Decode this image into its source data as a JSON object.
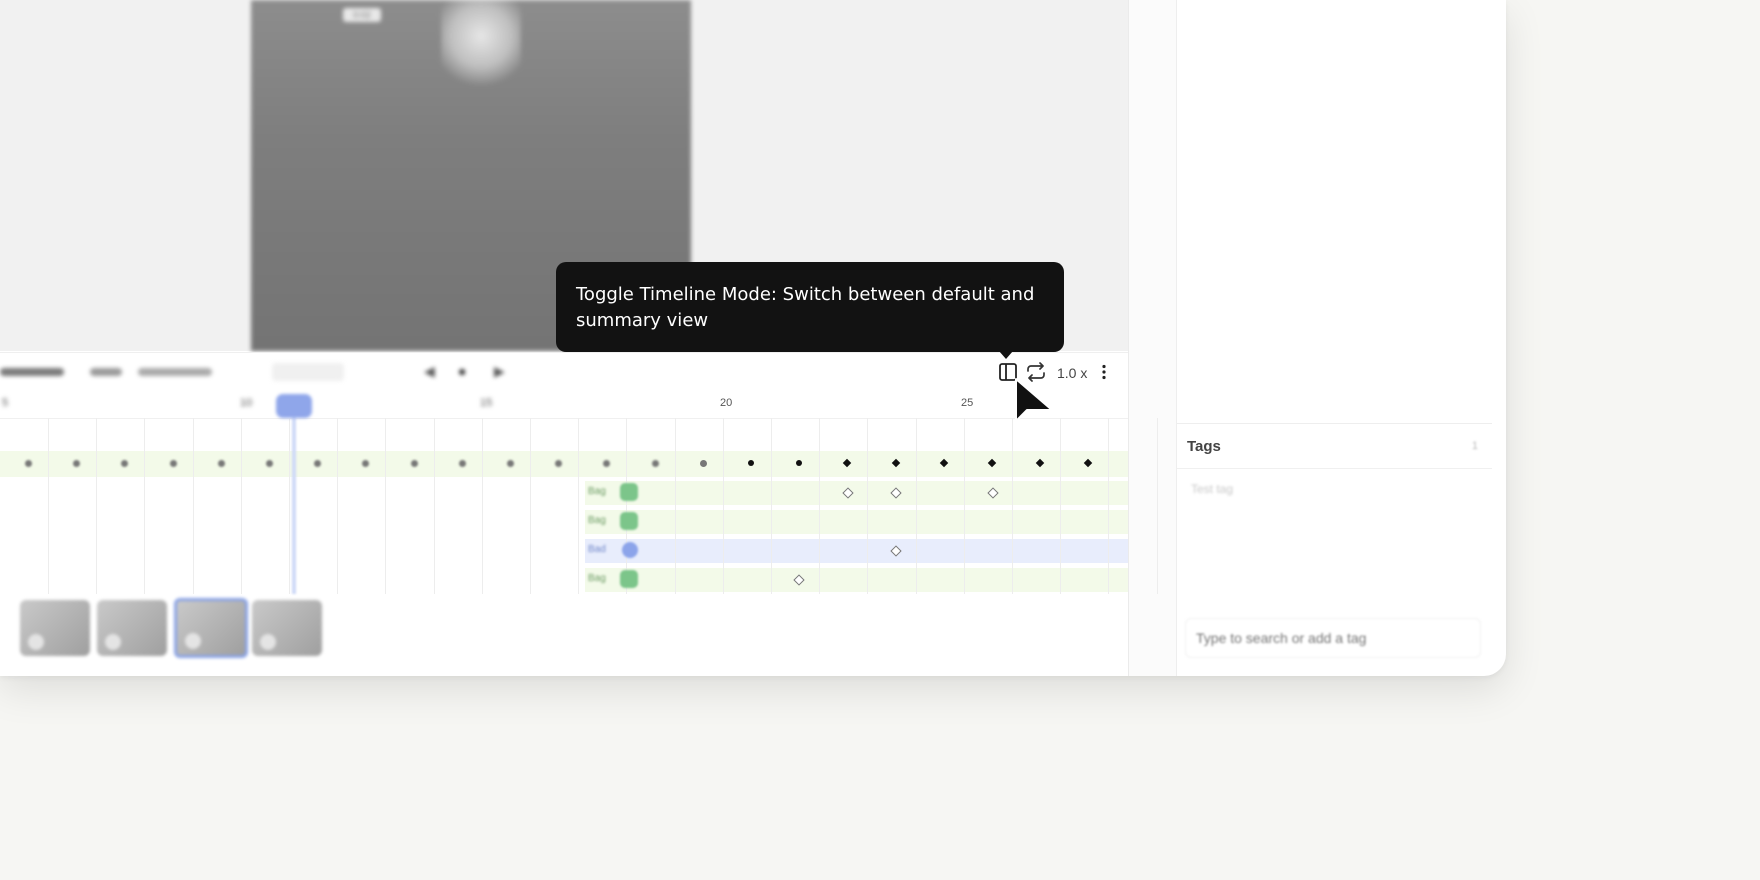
{
  "tooltip": {
    "text": "Toggle Timeline Mode: Switch between default and summary view"
  },
  "toolbar": {
    "speed_label": "1.0 x",
    "icons": [
      "timeline-mode-icon",
      "loop-icon",
      "more-vertical-icon"
    ]
  },
  "ruler": {
    "labels": [
      "5",
      "10",
      "15",
      "20",
      "25"
    ]
  },
  "tracks": {
    "labels": [
      "Bag",
      "Bag",
      "Bad",
      "Bag"
    ]
  },
  "tags_panel": {
    "title": "Tags",
    "count": "1",
    "tag_item": "Test tag",
    "input_placeholder": "Type to search or add a tag"
  },
  "viewer": {
    "frame_label": "0:02"
  },
  "colors": {
    "tooltip_bg": "#121212",
    "playhead": "#8fa6ea",
    "keyframe_track": "#f3fae9",
    "selected_track": "#e8edfc",
    "background": "#f6f6f3"
  }
}
